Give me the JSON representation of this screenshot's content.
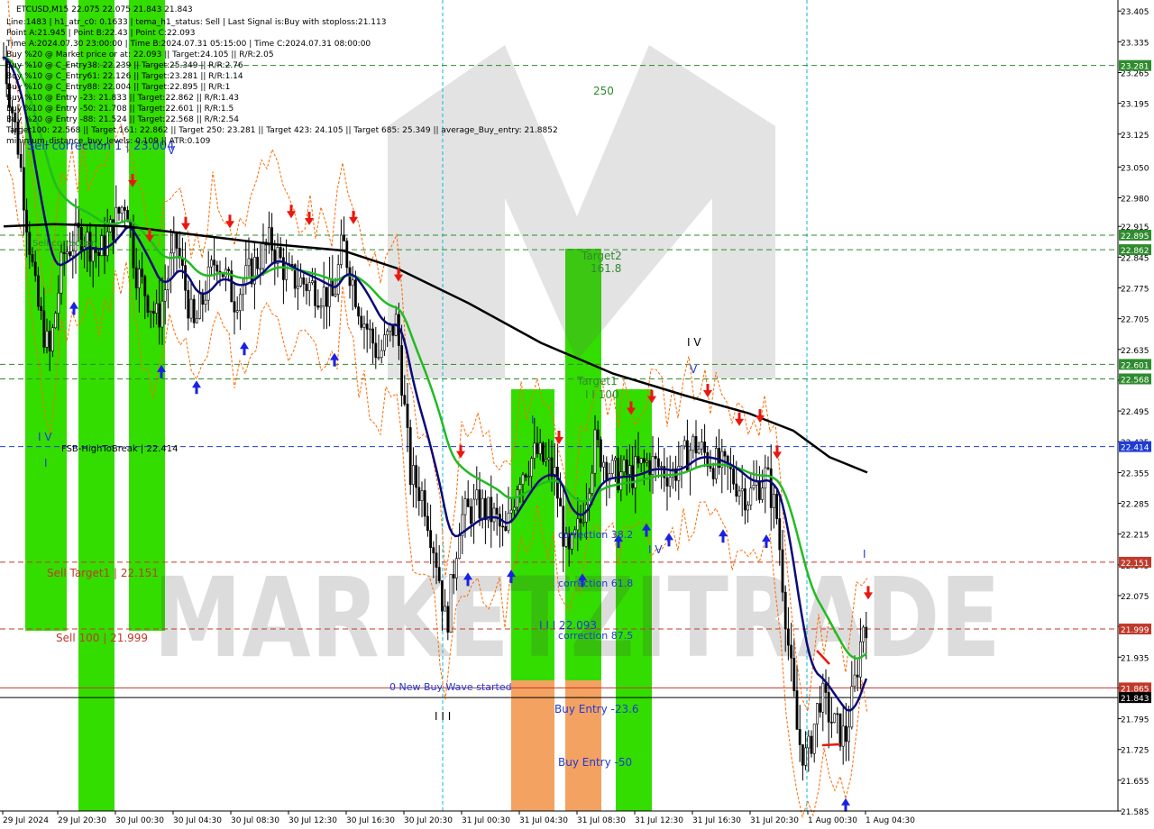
{
  "header": {
    "symbol_line": "ETCUSD,M15  22.075 22.075 21.843 21.843",
    "info_lines": [
      "Line:1483  |  h1_atr_c0: 0.1633  |  tema_h1_status: Sell  |  Last Signal is:Buy with stoploss:21.113",
      "Point A:21.945 | Point B:22.43 | Point C:22.093",
      "Time A:2024.07.30 23:00:00 | Time B:2024.07.31 05:15:00 | Time C:2024.07.31 08:00:00",
      "Buy %20 @ Market price or at: 22.093  ||  Target:24.105  ||  R/R:2.05",
      "Buy %10 @ C_Entry38: 22.239  ||  Target:25.349  ||  R/R:2.76",
      "Buy %10 @ C_Entry61: 22.126  ||  Target:23.281  ||  R/R:1.14",
      "Buy %10 @ C_Entry88: 22.004  ||  Target:22.895  ||  R/R:1",
      "Buy %10 @ Entry -23: 21.833  ||  Target:22.862  ||  R/R:1.43",
      "Buy %10 @ Entry -50: 21.708  ||  Target:22.601  ||  R/R:1.5",
      "Buy %20 @ Entry -88: 21.524  ||  Target:22.568  ||  R/R:2.54",
      "Target100: 22.568  ||  Target 161: 22.862  ||  Target 250: 23.281  ||  Target 423: 24.105  ||  Target 685: 25.349  ||  average_Buy_entry: 21.8852",
      "minimum_distance_buy_levels: 0.109  ||  ATR:0.109"
    ]
  },
  "chart_data": {
    "type": "candlestick",
    "symbol": "ETCUSD",
    "timeframe": "M15",
    "last_price": 21.843,
    "ylim": [
      21.585,
      23.43
    ],
    "y_ticks": [
      "23.405",
      "23.335",
      "23.265",
      "23.195",
      "23.125",
      "23.050",
      "22.980",
      "22.915",
      "22.845",
      "22.775",
      "22.705",
      "22.635",
      "22.565",
      "22.495",
      "22.425",
      "22.355",
      "22.285",
      "22.215",
      "22.145",
      "22.075",
      "22.005",
      "21.935",
      "21.865",
      "21.795",
      "21.725",
      "21.655",
      "21.585"
    ],
    "x_ticks": [
      "29 Jul 2024",
      "29 Jul 20:30",
      "30 Jul 00:30",
      "30 Jul 04:30",
      "30 Jul 08:30",
      "30 Jul 12:30",
      "30 Jul 16:30",
      "30 Jul 20:30",
      "31 Jul 00:30",
      "31 Jul 04:30",
      "31 Jul 08:30",
      "31 Jul 12:30",
      "31 Jul 16:30",
      "31 Jul 20:30",
      "1 Aug 00:30",
      "1 Aug 04:30"
    ],
    "price_levels": [
      {
        "value": 23.281,
        "label": "23.281",
        "color": "#2e8b2e",
        "style": "dashed"
      },
      {
        "value": 22.895,
        "label": "22.895",
        "color": "#2e8b2e",
        "style": "dashed"
      },
      {
        "value": 22.862,
        "label": "22.862",
        "color": "#2e8b2e",
        "style": "dashed"
      },
      {
        "value": 22.601,
        "label": "22.601",
        "color": "#2e8b2e",
        "style": "dashed"
      },
      {
        "value": 22.568,
        "label": "22.568",
        "color": "#2e8b2e",
        "style": "dashed"
      },
      {
        "value": 22.414,
        "label": "22.414",
        "color": "#1f3bd6",
        "style": "dashed"
      },
      {
        "value": 22.151,
        "label": "22.151",
        "color": "#c0392b",
        "style": "dashed"
      },
      {
        "value": 21.999,
        "label": "21.999",
        "color": "#c0392b",
        "style": "dashed"
      },
      {
        "value": 21.865,
        "label": "21.865",
        "color": "#c0392b",
        "style": "solid"
      },
      {
        "value": 21.843,
        "label": "21.843",
        "color": "#000000",
        "style": "solid"
      }
    ],
    "annotations": [
      {
        "text": "250",
        "color": "#2e8b2e"
      },
      {
        "text": "Target2",
        "color": "#2e8b2e"
      },
      {
        "text": "161.8",
        "color": "#2e8b2e"
      },
      {
        "text": "Target1",
        "color": "#2e8b2e"
      },
      {
        "text": "I I 100",
        "color": "#2e8b2e"
      },
      {
        "text": "I V",
        "color": "#000000"
      },
      {
        "text": "V",
        "color": "#1f3bd6"
      },
      {
        "text": "I",
        "color": "#1f3bd6"
      },
      {
        "text": "I V",
        "color": "#1f3bd6"
      },
      {
        "text": "I",
        "color": "#1f3bd6"
      },
      {
        "text": "FSB-HighToBreak  |  22.414",
        "color": "#000000"
      },
      {
        "text": "Sell Target1  |  22.151",
        "color": "#c0392b"
      },
      {
        "text": "Sell 100  |  21.999",
        "color": "#c0392b"
      },
      {
        "text": "correction 38.2",
        "color": "#1f3bd6"
      },
      {
        "text": "correction 61.8",
        "color": "#1f3bd6"
      },
      {
        "text": "correction 87.5",
        "color": "#1f3bd6"
      },
      {
        "text": "I I I  22.093",
        "color": "#1f3bd6"
      },
      {
        "text": "0 New Buy Wave started",
        "color": "#1f3bd6"
      },
      {
        "text": "Buy Entry -23.6",
        "color": "#1f3bd6"
      },
      {
        "text": "Buy Entry -50",
        "color": "#1f3bd6"
      },
      {
        "text": "I I I",
        "color": "#000000"
      },
      {
        "text": "Sell correction 1 | 23.004",
        "color": "#1f3bd6"
      },
      {
        "text": "I V",
        "color": "#1f3bd6"
      },
      {
        "text": "Sell correction",
        "color": "#2e8b2e"
      },
      {
        "text": "I",
        "color": "#1f3bd6"
      },
      {
        "text": "V",
        "color": "#1f3bd6"
      }
    ],
    "watermark": "MARKETZITRADE",
    "colors": {
      "zone_green": "#33dd00",
      "zone_orange": "#f4a261",
      "ema_green": "#22bb22",
      "ema_blue": "#0a0a7a",
      "ema_black": "#000000",
      "band_orange": "#ff6a00",
      "arrow_red": "#e8170f",
      "arrow_blue": "#1a22e0",
      "candle_bull": "#ffffff",
      "candle_bear": "#000000"
    }
  }
}
